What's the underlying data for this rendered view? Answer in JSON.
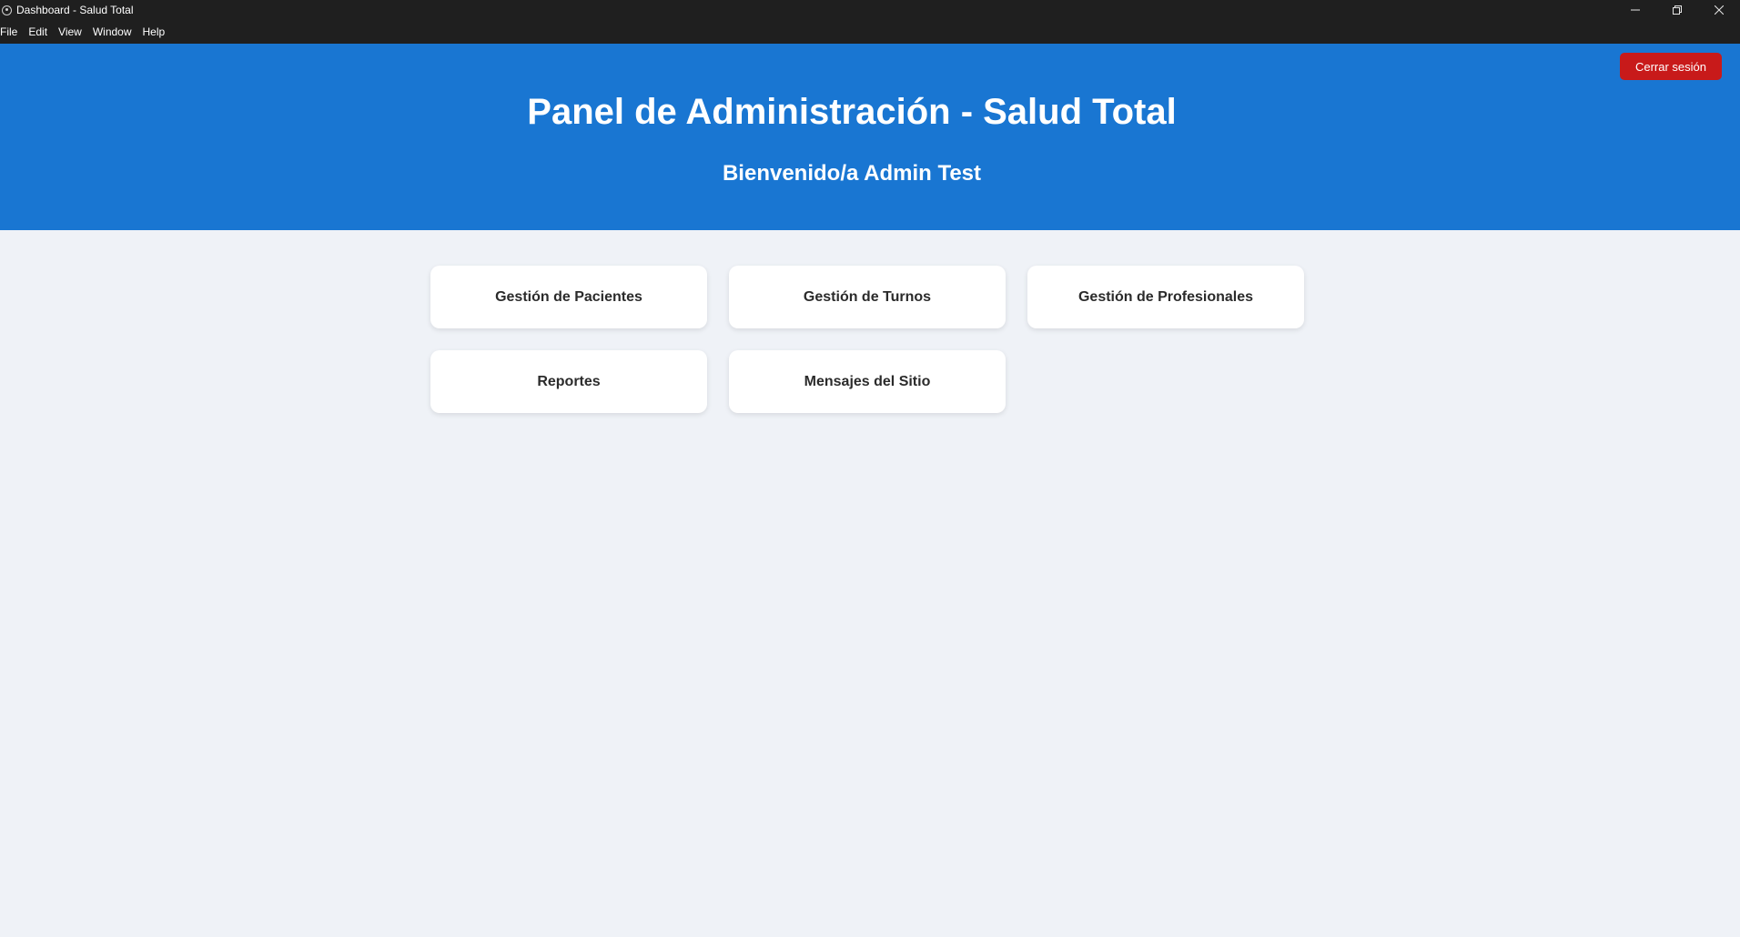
{
  "window": {
    "title": "Dashboard - Salud Total",
    "icon": "app-icon"
  },
  "menubar": {
    "items": [
      "File",
      "Edit",
      "View",
      "Window",
      "Help"
    ]
  },
  "header": {
    "title": "Panel de Administración - Salud Total",
    "welcome": "Bienvenido/a Admin Test",
    "logout_label": "Cerrar sesión",
    "background_color": "#1976d2",
    "logout_color": "#c81a1a"
  },
  "cards": [
    {
      "label": "Gestión de Pacientes"
    },
    {
      "label": "Gestión de Turnos"
    },
    {
      "label": "Gestión de Profesionales"
    },
    {
      "label": "Reportes"
    },
    {
      "label": "Mensajes del Sitio"
    }
  ]
}
